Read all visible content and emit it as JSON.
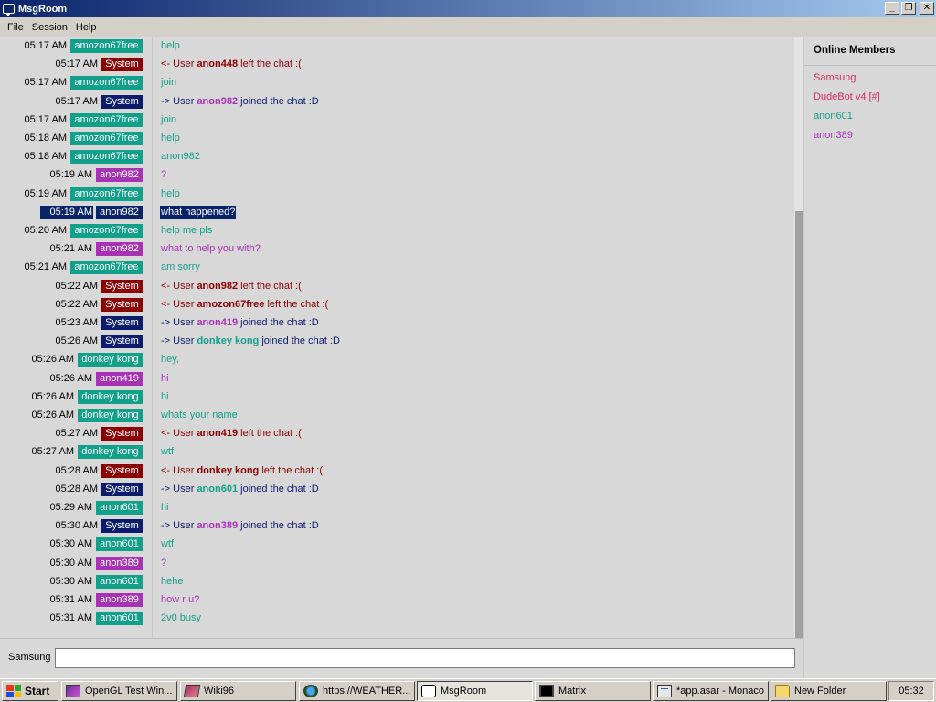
{
  "window": {
    "title": "MsgRoom",
    "buttons": {
      "minimize": "_",
      "maximize": "❐",
      "close": "✕"
    }
  },
  "menu": [
    "File",
    "Session",
    "Help"
  ],
  "colors": {
    "amozon67free": "#11a08a",
    "System-leave": "#8b0000",
    "System-join": "#0b1c6d",
    "anon982": "#a832b4",
    "anon419": "#a832b4",
    "donkey kong": "#11a08a",
    "anon601": "#11a08a",
    "anon389": "#a832b4",
    "selection": "#0a246a"
  },
  "messages": [
    {
      "time": "05:17 AM",
      "user": "amozon67free",
      "color": "#11a08a",
      "text": "help"
    },
    {
      "time": "05:17 AM",
      "user": "System",
      "color": "#8b0000",
      "pre": "<- User ",
      "name": "anon448",
      "post": " left the chat :("
    },
    {
      "time": "05:17 AM",
      "user": "amozon67free",
      "color": "#11a08a",
      "text": "join"
    },
    {
      "time": "05:17 AM",
      "user": "System",
      "color": "#0b1c6d",
      "pre": "-> User ",
      "name": "anon982",
      "nameColor": "#a832b4",
      "post": " joined the chat :D"
    },
    {
      "time": "05:17 AM",
      "user": "amozon67free",
      "color": "#11a08a",
      "text": "join"
    },
    {
      "time": "05:18 AM",
      "user": "amozon67free",
      "color": "#11a08a",
      "text": "help"
    },
    {
      "time": "05:18 AM",
      "user": "amozon67free",
      "color": "#11a08a",
      "text": "anon982"
    },
    {
      "time": "05:19 AM",
      "user": "anon982",
      "color": "#a832b4",
      "text": "?"
    },
    {
      "time": "05:19 AM",
      "user": "amozon67free",
      "color": "#11a08a",
      "text": "help"
    },
    {
      "time": "05:19 AM",
      "user": "anon982",
      "color": "#a832b4",
      "text": "what happened?",
      "selected": true
    },
    {
      "time": "05:20 AM",
      "user": "amozon67free",
      "color": "#11a08a",
      "text": "help me pls"
    },
    {
      "time": "05:21 AM",
      "user": "anon982",
      "color": "#a832b4",
      "text": "what to help you with?"
    },
    {
      "time": "05:21 AM",
      "user": "amozon67free",
      "color": "#11a08a",
      "text": "am sorry"
    },
    {
      "time": "05:22 AM",
      "user": "System",
      "color": "#8b0000",
      "pre": "<- User ",
      "name": "anon982",
      "post": " left the chat :("
    },
    {
      "time": "05:22 AM",
      "user": "System",
      "color": "#8b0000",
      "pre": "<- User ",
      "name": "amozon67free",
      "post": " left the chat :("
    },
    {
      "time": "05:23 AM",
      "user": "System",
      "color": "#0b1c6d",
      "pre": "-> User ",
      "name": "anon419",
      "nameColor": "#a832b4",
      "post": " joined the chat :D"
    },
    {
      "time": "05:26 AM",
      "user": "System",
      "color": "#0b1c6d",
      "pre": "-> User ",
      "name": "donkey kong",
      "nameColor": "#11a08a",
      "post": " joined the chat :D"
    },
    {
      "time": "05:26 AM",
      "user": "donkey kong",
      "color": "#11a08a",
      "text": "hey,"
    },
    {
      "time": "05:26 AM",
      "user": "anon419",
      "color": "#a832b4",
      "text": "hi"
    },
    {
      "time": "05:26 AM",
      "user": "donkey kong",
      "color": "#11a08a",
      "text": "hi"
    },
    {
      "time": "05:26 AM",
      "user": "donkey kong",
      "color": "#11a08a",
      "text": "whats your name"
    },
    {
      "time": "05:27 AM",
      "user": "System",
      "color": "#8b0000",
      "pre": "<- User ",
      "name": "anon419",
      "post": " left the chat :("
    },
    {
      "time": "05:27 AM",
      "user": "donkey kong",
      "color": "#11a08a",
      "text": "wtf"
    },
    {
      "time": "05:28 AM",
      "user": "System",
      "color": "#8b0000",
      "pre": "<- User ",
      "name": "donkey kong",
      "post": " left the chat :("
    },
    {
      "time": "05:28 AM",
      "user": "System",
      "color": "#0b1c6d",
      "pre": "-> User ",
      "name": "anon601",
      "nameColor": "#11a08a",
      "post": " joined the chat :D"
    },
    {
      "time": "05:29 AM",
      "user": "anon601",
      "color": "#11a08a",
      "text": "hi"
    },
    {
      "time": "05:30 AM",
      "user": "System",
      "color": "#0b1c6d",
      "pre": "-> User ",
      "name": "anon389",
      "nameColor": "#a832b4",
      "post": " joined the chat :D"
    },
    {
      "time": "05:30 AM",
      "user": "anon601",
      "color": "#11a08a",
      "text": "wtf"
    },
    {
      "time": "05:30 AM",
      "user": "anon389",
      "color": "#a832b4",
      "text": "?"
    },
    {
      "time": "05:30 AM",
      "user": "anon601",
      "color": "#11a08a",
      "text": "hehe"
    },
    {
      "time": "05:31 AM",
      "user": "anon389",
      "color": "#a832b4",
      "text": "how r u?"
    },
    {
      "time": "05:31 AM",
      "user": "anon601",
      "color": "#11a08a",
      "text": "2v0 busy"
    }
  ],
  "members": {
    "title": "Online Members",
    "list": [
      {
        "name": "Samsung",
        "color": "#d12d5d"
      },
      {
        "name": "DudeBot v4 [#]",
        "color": "#d12d5d"
      },
      {
        "name": "anon601",
        "color": "#11a08a"
      },
      {
        "name": "anon389",
        "color": "#a832b4"
      }
    ]
  },
  "input": {
    "nickname": "Samsung",
    "value": ""
  },
  "taskbar": {
    "start": "Start",
    "items": [
      {
        "label": "OpenGL Test Win...",
        "icon": "opengl-icon",
        "active": false
      },
      {
        "label": "Wiki96",
        "icon": "book-icon",
        "active": false
      },
      {
        "label": "https://WEATHER...",
        "icon": "browser-icon",
        "active": false
      },
      {
        "label": "MsgRoom",
        "icon": "chat-icon",
        "active": true
      },
      {
        "label": "Matrix",
        "icon": "terminal-icon",
        "active": false
      },
      {
        "label": "*app.asar - Monaco",
        "icon": "editor-icon",
        "active": false
      },
      {
        "label": "New Folder",
        "icon": "folder-icon",
        "active": false
      }
    ],
    "clock": "05:32"
  }
}
